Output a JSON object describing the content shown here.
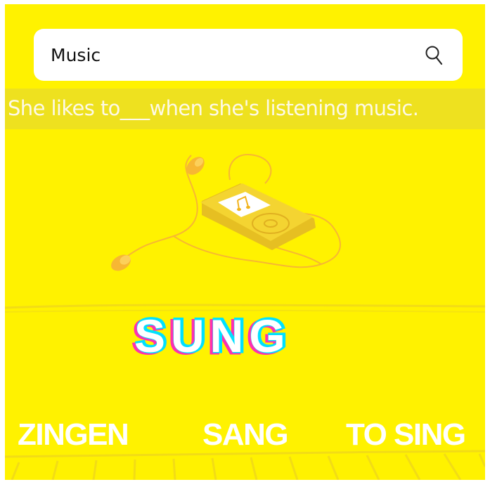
{
  "search": {
    "value": "Music",
    "icon": "search-icon"
  },
  "question": {
    "text": "She likes to___when she's listening music."
  },
  "illustration": {
    "icon": "music-player-with-earphones-icon",
    "screen_icon": "music-note-icon"
  },
  "answer": {
    "text": "SUNG"
  },
  "options": [
    {
      "label": "ZINGEN"
    },
    {
      "label": "SANG"
    },
    {
      "label": "TO SING"
    }
  ],
  "colors": {
    "background": "#fff200",
    "band": "#eee11f",
    "player": "#f4d431",
    "player_dark": "#e6bf22",
    "earphone": "#f7b733",
    "answer_cyan": "#00e0ff",
    "answer_magenta": "#ff2fb0",
    "text_light": "#ffffff"
  }
}
